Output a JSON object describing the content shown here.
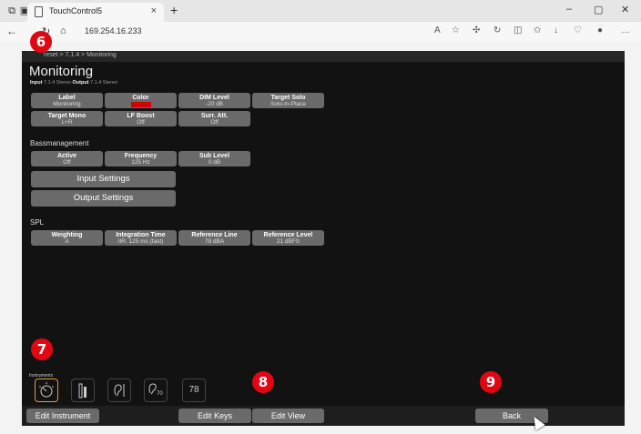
{
  "browser": {
    "tab_title": "TouchControl5",
    "tab_close": "×",
    "new_tab": "+",
    "url": "169.254.16.233",
    "window": {
      "minimize": "–",
      "maximize": "▢",
      "close": "✕"
    }
  },
  "app": {
    "breadcrumb": "reset > 7.1.4 > Monitoring",
    "title": "Monitoring",
    "io_line": {
      "input_label": "Input",
      "input_value": "7.1.4 Stereo",
      "output_label": "Output",
      "output_value": "7.1.4 Stereo"
    },
    "controls": [
      {
        "label": "Label",
        "value": "Monitoring"
      },
      {
        "label": "Color",
        "value": "",
        "color": "#d40000"
      },
      {
        "label": "DIM Level",
        "value": "-20 dB"
      },
      {
        "label": "Target Solo",
        "value": "Solo-In-Place"
      },
      {
        "label": "Target Mono",
        "value": "L+R"
      },
      {
        "label": "LF Boost",
        "value": "Off"
      },
      {
        "label": "Surr. Att.",
        "value": "Off"
      }
    ],
    "bassmanagement": {
      "heading": "Bassmanagement",
      "controls": [
        {
          "label": "Active",
          "value": "Off"
        },
        {
          "label": "Frequency",
          "value": "125 Hz"
        },
        {
          "label": "Sub Level",
          "value": "0 dB"
        }
      ],
      "input_settings": "Input Settings",
      "output_settings": "Output Settings"
    },
    "spl": {
      "heading": "SPL",
      "controls": [
        {
          "label": "Weighting",
          "value": "A"
        },
        {
          "label": "Integration Time",
          "value": "IIR: 125 ms (fast)"
        },
        {
          "label": "Reference Line",
          "value": "78 dBA"
        },
        {
          "label": "Reference Level",
          "value": "21 dBFS"
        }
      ]
    },
    "instruments": {
      "label": "Instruments",
      "items": [
        {
          "icon": "meter-dial-icon",
          "text": ""
        },
        {
          "icon": "level-bar-icon",
          "text": ""
        },
        {
          "icon": "ear-icon",
          "text": ""
        },
        {
          "icon": "ear-70-icon",
          "text": "70"
        },
        {
          "icon": "spl-78-icon",
          "text": "78"
        }
      ]
    },
    "bottom": {
      "edit_instrument": "Edit Instrument",
      "edit_keys": "Edit Keys",
      "edit_view": "Edit View",
      "back": "Back"
    }
  },
  "callouts": [
    "6",
    "7",
    "8",
    "9"
  ]
}
